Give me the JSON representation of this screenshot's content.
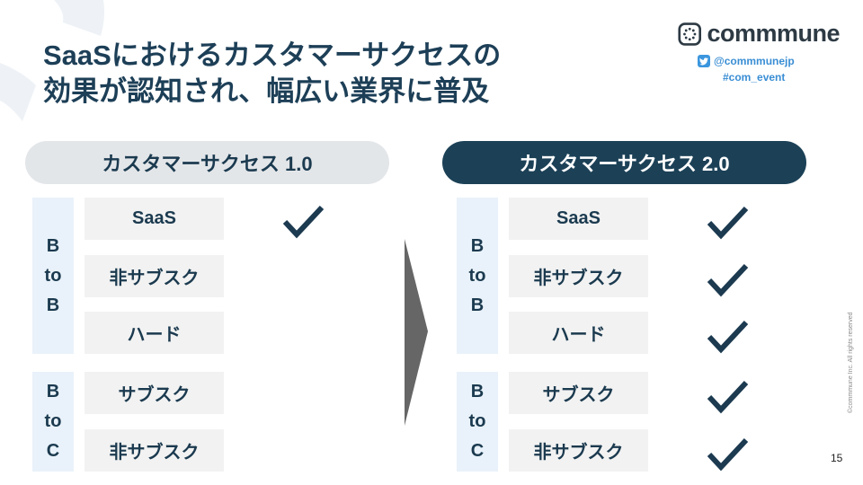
{
  "slide": {
    "title_lines": [
      "SaaSにおけるカスタマーサクセスの",
      "効果が認知され、幅広い業界に普及"
    ],
    "page_number": "15",
    "copyright": "©commmune Inc. All rights reserved"
  },
  "brand": {
    "logo_text": "commmune",
    "twitter_handle": "@commmunejp",
    "hashtag": "#com_event",
    "colors": {
      "primary": "#1c4157",
      "twitter": "#3b96de"
    }
  },
  "comparison": {
    "left": {
      "title": "カスタマーサクセス 1.0",
      "groups": [
        {
          "label": [
            "B",
            "to",
            "B"
          ],
          "items": [
            {
              "name": "SaaS",
              "checked": true
            },
            {
              "name": "非サブスク",
              "checked": false
            },
            {
              "name": "ハード",
              "checked": false
            }
          ]
        },
        {
          "label": [
            "B",
            "to",
            "C"
          ],
          "items": [
            {
              "name": "サブスク",
              "checked": false
            },
            {
              "name": "非サブスク",
              "checked": false
            }
          ]
        }
      ]
    },
    "right": {
      "title": "カスタマーサクセス 2.0",
      "groups": [
        {
          "label": [
            "B",
            "to",
            "B"
          ],
          "items": [
            {
              "name": "SaaS",
              "checked": true
            },
            {
              "name": "非サブスク",
              "checked": true
            },
            {
              "name": "ハード",
              "checked": true
            }
          ]
        },
        {
          "label": [
            "B",
            "to",
            "C"
          ],
          "items": [
            {
              "name": "サブスク",
              "checked": true
            },
            {
              "name": "非サブスク",
              "checked": true
            }
          ]
        }
      ]
    }
  }
}
